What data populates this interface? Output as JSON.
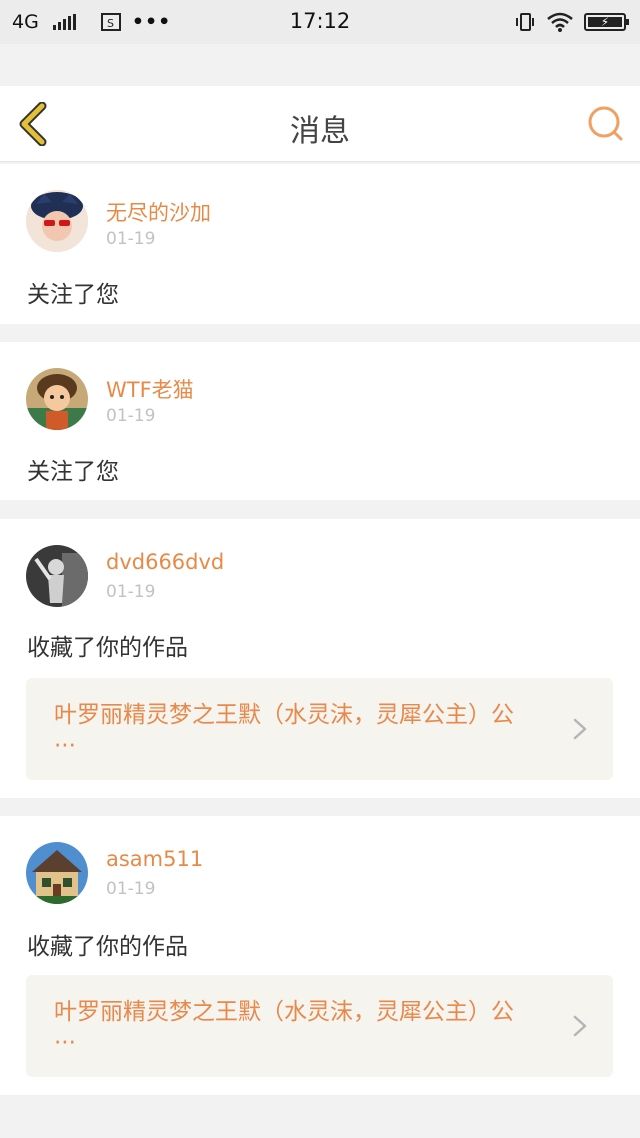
{
  "status_bar": {
    "network": "4G",
    "sim_icon": "sim-card-icon",
    "more": "•••",
    "time": "17:12",
    "icons": [
      "vibrate-icon",
      "wifi-icon",
      "battery-charging-icon"
    ]
  },
  "header": {
    "title": "消息",
    "back_icon": "chevron-left-icon",
    "search_icon": "search-icon",
    "accent_color": "#e3c034",
    "search_color": "#f0a060"
  },
  "messages": [
    {
      "user": "无尽的沙加",
      "date": "01-19",
      "action": "关注了您"
    },
    {
      "user": "WTF老猫",
      "date": "01-19",
      "action": "关注了您"
    },
    {
      "user": "dvd666dvd",
      "date": "01-19",
      "action": "收藏了你的作品",
      "work_title": "叶罗丽精灵梦之王默（水灵沫，灵犀公主）公···"
    },
    {
      "user": "asam511",
      "date": "01-19",
      "action": "收藏了你的作品",
      "work_title": "叶罗丽精灵梦之王默（水灵沫，灵犀公主）公···"
    }
  ],
  "colors": {
    "username": "#e88a47",
    "date": "#c2c2c2",
    "page_bg": "#f2f2f2"
  }
}
